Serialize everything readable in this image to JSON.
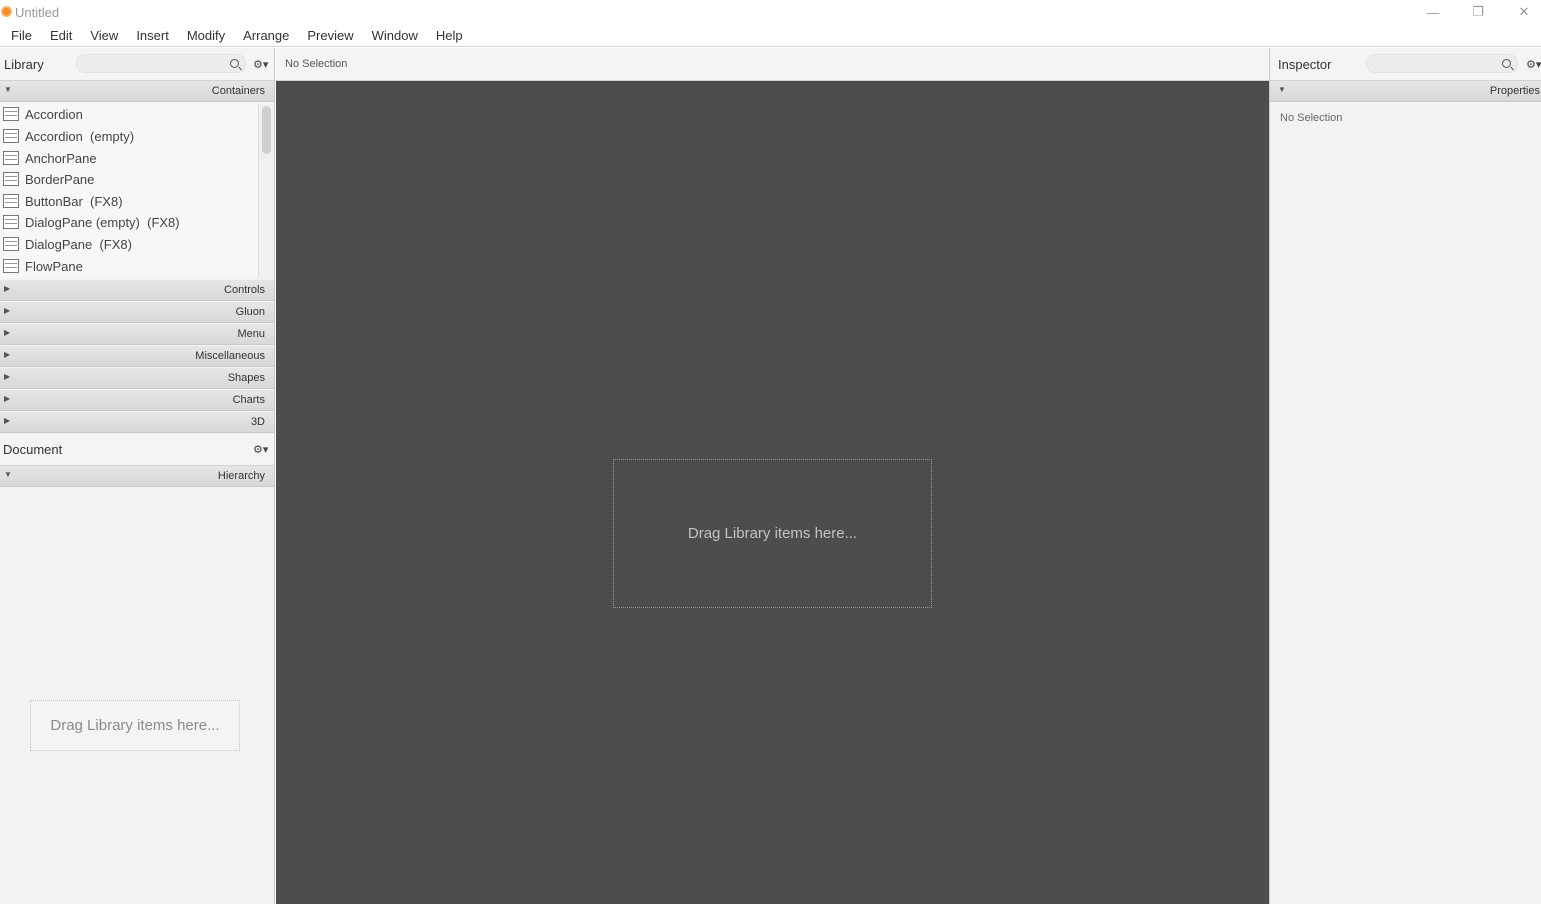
{
  "window": {
    "title": "Untitled",
    "minimize_glyph": "—",
    "restore_glyph": "❐",
    "close_glyph": "✕"
  },
  "menu": [
    "File",
    "Edit",
    "View",
    "Insert",
    "Modify",
    "Arrange",
    "Preview",
    "Window",
    "Help"
  ],
  "library": {
    "title": "Library",
    "search_placeholder": "",
    "sections": {
      "containers": "Containers",
      "controls": "Controls",
      "gluon": "Gluon",
      "menu": "Menu",
      "miscellaneous": "Miscellaneous",
      "shapes": "Shapes",
      "charts": "Charts",
      "3d": "3D"
    },
    "items": [
      "Accordion",
      "Accordion  (empty)",
      "AnchorPane",
      "BorderPane",
      "ButtonBar  (FX8)",
      "DialogPane (empty)  (FX8)",
      "DialogPane  (FX8)",
      "FlowPane"
    ]
  },
  "document": {
    "title": "Document",
    "hierarchy_label": "Hierarchy",
    "drop_hint": "Drag Library items here..."
  },
  "center": {
    "selection": "No Selection",
    "drop_hint": "Drag Library items here..."
  },
  "inspector": {
    "title": "Inspector",
    "properties_label": "Properties",
    "selection": "No Selection"
  },
  "icons": {
    "gear": "⚙▾",
    "arrow_down": "▼",
    "arrow_right": "▶"
  }
}
